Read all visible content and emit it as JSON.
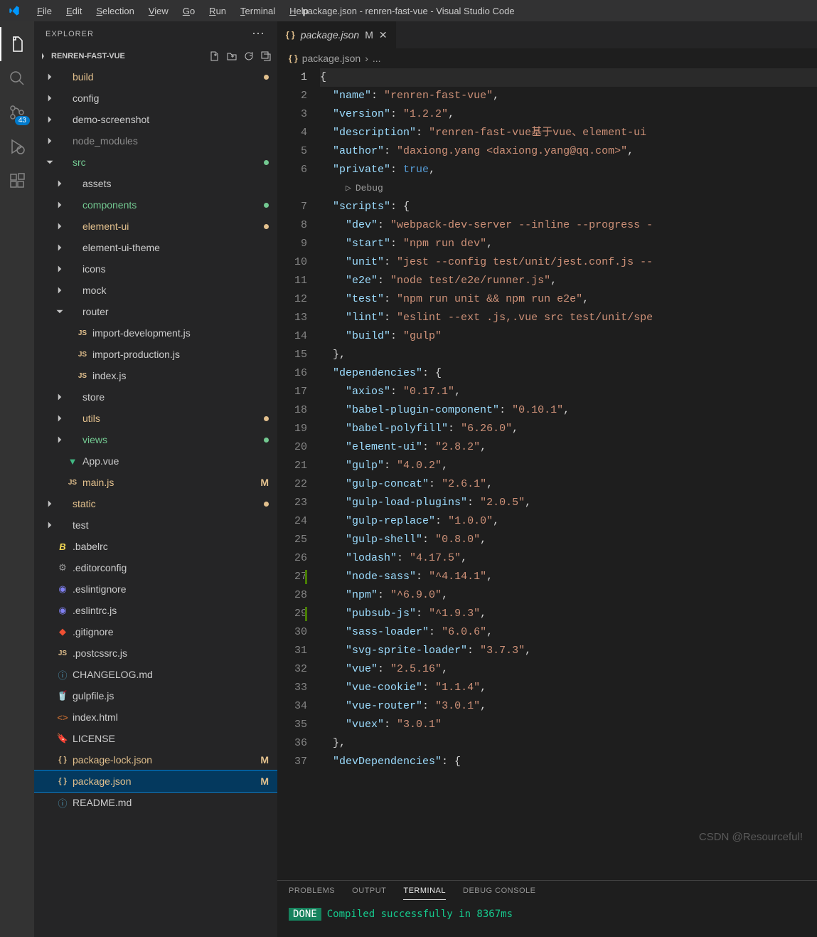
{
  "title": "package.json - renren-fast-vue - Visual Studio Code",
  "menu": [
    {
      "u": "F",
      "rest": "ile"
    },
    {
      "u": "E",
      "rest": "dit"
    },
    {
      "u": "S",
      "rest": "election"
    },
    {
      "u": "V",
      "rest": "iew"
    },
    {
      "u": "G",
      "rest": "o"
    },
    {
      "u": "R",
      "rest": "un"
    },
    {
      "u": "T",
      "rest": "erminal"
    },
    {
      "u": "H",
      "rest": "elp"
    }
  ],
  "activity": {
    "scm_badge": "43"
  },
  "sidebar": {
    "title": "EXPLORER",
    "section": "RENREN-FAST-VUE",
    "tree": [
      {
        "d": 1,
        "t": "folder",
        "open": false,
        "label": "build",
        "cls": "c-modified",
        "dot": "dot-modified"
      },
      {
        "d": 1,
        "t": "folder",
        "open": false,
        "label": "config",
        "cls": "c-default"
      },
      {
        "d": 1,
        "t": "folder",
        "open": false,
        "label": "demo-screenshot",
        "cls": "c-default"
      },
      {
        "d": 1,
        "t": "folder",
        "open": false,
        "label": "node_modules",
        "cls": "c-ignored"
      },
      {
        "d": 1,
        "t": "folder",
        "open": true,
        "label": "src",
        "cls": "c-untracked",
        "dot": "dot-untracked"
      },
      {
        "d": 2,
        "t": "folder",
        "open": false,
        "label": "assets",
        "cls": "c-default"
      },
      {
        "d": 2,
        "t": "folder",
        "open": false,
        "label": "components",
        "cls": "c-untracked",
        "dot": "dot-untracked"
      },
      {
        "d": 2,
        "t": "folder",
        "open": false,
        "label": "element-ui",
        "cls": "c-modified",
        "dot": "dot-modified"
      },
      {
        "d": 2,
        "t": "folder",
        "open": false,
        "label": "element-ui-theme",
        "cls": "c-default"
      },
      {
        "d": 2,
        "t": "folder",
        "open": false,
        "label": "icons",
        "cls": "c-default"
      },
      {
        "d": 2,
        "t": "folder",
        "open": false,
        "label": "mock",
        "cls": "c-default"
      },
      {
        "d": 2,
        "t": "folder",
        "open": true,
        "label": "router",
        "cls": "c-default"
      },
      {
        "d": 3,
        "t": "file",
        "icon": "js",
        "label": "import-development.js",
        "cls": "c-default"
      },
      {
        "d": 3,
        "t": "file",
        "icon": "js",
        "label": "import-production.js",
        "cls": "c-default"
      },
      {
        "d": 3,
        "t": "file",
        "icon": "js",
        "label": "index.js",
        "cls": "c-default"
      },
      {
        "d": 2,
        "t": "folder",
        "open": false,
        "label": "store",
        "cls": "c-default"
      },
      {
        "d": 2,
        "t": "folder",
        "open": false,
        "label": "utils",
        "cls": "c-modified",
        "dot": "dot-modified"
      },
      {
        "d": 2,
        "t": "folder",
        "open": false,
        "label": "views",
        "cls": "c-untracked",
        "dot": "dot-untracked"
      },
      {
        "d": 2,
        "t": "file",
        "icon": "vue",
        "label": "App.vue",
        "cls": "c-default"
      },
      {
        "d": 2,
        "t": "file",
        "icon": "js",
        "label": "main.js",
        "cls": "c-modified",
        "status": "M"
      },
      {
        "d": 1,
        "t": "folder",
        "open": false,
        "label": "static",
        "cls": "c-modified",
        "dot": "dot-modified"
      },
      {
        "d": 1,
        "t": "folder",
        "open": false,
        "label": "test",
        "cls": "c-default"
      },
      {
        "d": 1,
        "t": "file",
        "icon": "babel",
        "label": ".babelrc",
        "cls": "c-default"
      },
      {
        "d": 1,
        "t": "file",
        "icon": "gear",
        "label": ".editorconfig",
        "cls": "c-default"
      },
      {
        "d": 1,
        "t": "file",
        "icon": "eslint",
        "label": ".eslintignore",
        "cls": "c-default"
      },
      {
        "d": 1,
        "t": "file",
        "icon": "eslint",
        "label": ".eslintrc.js",
        "cls": "c-default"
      },
      {
        "d": 1,
        "t": "file",
        "icon": "git",
        "label": ".gitignore",
        "cls": "c-default"
      },
      {
        "d": 1,
        "t": "file",
        "icon": "js",
        "label": ".postcssrc.js",
        "cls": "c-default"
      },
      {
        "d": 1,
        "t": "file",
        "icon": "info",
        "label": "CHANGELOG.md",
        "cls": "c-default"
      },
      {
        "d": 1,
        "t": "file",
        "icon": "gulp",
        "label": "gulpfile.js",
        "cls": "c-default"
      },
      {
        "d": 1,
        "t": "file",
        "icon": "html",
        "label": "index.html",
        "cls": "c-default"
      },
      {
        "d": 1,
        "t": "file",
        "icon": "license",
        "label": "LICENSE",
        "cls": "c-default"
      },
      {
        "d": 1,
        "t": "file",
        "icon": "json",
        "label": "package-lock.json",
        "cls": "c-modified",
        "status": "M"
      },
      {
        "d": 1,
        "t": "file",
        "icon": "json",
        "label": "package.json",
        "cls": "c-modified",
        "status": "M",
        "selected": true
      },
      {
        "d": 1,
        "t": "file",
        "icon": "info",
        "label": "README.md",
        "cls": "c-default"
      }
    ]
  },
  "tab": {
    "name": "package.json",
    "modified": "M"
  },
  "breadcrumb": {
    "file": "package.json",
    "sep": "›",
    "more": "..."
  },
  "codelens": "Debug",
  "code": [
    {
      "n": 1,
      "hl": true,
      "tokens": [
        {
          "c": "p",
          "v": "{"
        }
      ]
    },
    {
      "n": 2,
      "tokens": [
        {
          "c": "p",
          "v": "  "
        },
        {
          "c": "k",
          "v": "\"name\""
        },
        {
          "c": "p",
          "v": ": "
        },
        {
          "c": "s",
          "v": "\"renren-fast-vue\""
        },
        {
          "c": "p",
          "v": ","
        }
      ]
    },
    {
      "n": 3,
      "tokens": [
        {
          "c": "p",
          "v": "  "
        },
        {
          "c": "k",
          "v": "\"version\""
        },
        {
          "c": "p",
          "v": ": "
        },
        {
          "c": "s",
          "v": "\"1.2.2\""
        },
        {
          "c": "p",
          "v": ","
        }
      ]
    },
    {
      "n": 4,
      "tokens": [
        {
          "c": "p",
          "v": "  "
        },
        {
          "c": "k",
          "v": "\"description\""
        },
        {
          "c": "p",
          "v": ": "
        },
        {
          "c": "s",
          "v": "\"renren-fast-vue基于vue、element-ui"
        }
      ]
    },
    {
      "n": 5,
      "tokens": [
        {
          "c": "p",
          "v": "  "
        },
        {
          "c": "k",
          "v": "\"author\""
        },
        {
          "c": "p",
          "v": ": "
        },
        {
          "c": "s",
          "v": "\"daxiong.yang <daxiong.yang@qq.com>\""
        },
        {
          "c": "p",
          "v": ","
        }
      ]
    },
    {
      "n": 6,
      "tokens": [
        {
          "c": "p",
          "v": "  "
        },
        {
          "c": "k",
          "v": "\"private\""
        },
        {
          "c": "p",
          "v": ": "
        },
        {
          "c": "b",
          "v": "true"
        },
        {
          "c": "p",
          "v": ","
        }
      ]
    },
    {
      "codelens": true
    },
    {
      "n": 7,
      "tokens": [
        {
          "c": "p",
          "v": "  "
        },
        {
          "c": "k",
          "v": "\"scripts\""
        },
        {
          "c": "p",
          "v": ": {"
        }
      ]
    },
    {
      "n": 8,
      "tokens": [
        {
          "c": "p",
          "v": "    "
        },
        {
          "c": "k",
          "v": "\"dev\""
        },
        {
          "c": "p",
          "v": ": "
        },
        {
          "c": "s",
          "v": "\"webpack-dev-server --inline --progress -"
        }
      ]
    },
    {
      "n": 9,
      "tokens": [
        {
          "c": "p",
          "v": "    "
        },
        {
          "c": "k",
          "v": "\"start\""
        },
        {
          "c": "p",
          "v": ": "
        },
        {
          "c": "s",
          "v": "\"npm run dev\""
        },
        {
          "c": "p",
          "v": ","
        }
      ]
    },
    {
      "n": 10,
      "tokens": [
        {
          "c": "p",
          "v": "    "
        },
        {
          "c": "k",
          "v": "\"unit\""
        },
        {
          "c": "p",
          "v": ": "
        },
        {
          "c": "s",
          "v": "\"jest --config test/unit/jest.conf.js --"
        }
      ]
    },
    {
      "n": 11,
      "tokens": [
        {
          "c": "p",
          "v": "    "
        },
        {
          "c": "k",
          "v": "\"e2e\""
        },
        {
          "c": "p",
          "v": ": "
        },
        {
          "c": "s",
          "v": "\"node test/e2e/runner.js\""
        },
        {
          "c": "p",
          "v": ","
        }
      ]
    },
    {
      "n": 12,
      "tokens": [
        {
          "c": "p",
          "v": "    "
        },
        {
          "c": "k",
          "v": "\"test\""
        },
        {
          "c": "p",
          "v": ": "
        },
        {
          "c": "s",
          "v": "\"npm run unit && npm run e2e\""
        },
        {
          "c": "p",
          "v": ","
        }
      ]
    },
    {
      "n": 13,
      "tokens": [
        {
          "c": "p",
          "v": "    "
        },
        {
          "c": "k",
          "v": "\"lint\""
        },
        {
          "c": "p",
          "v": ": "
        },
        {
          "c": "s",
          "v": "\"eslint --ext .js,.vue src test/unit/spe"
        }
      ]
    },
    {
      "n": 14,
      "tokens": [
        {
          "c": "p",
          "v": "    "
        },
        {
          "c": "k",
          "v": "\"build\""
        },
        {
          "c": "p",
          "v": ": "
        },
        {
          "c": "s",
          "v": "\"gulp\""
        }
      ]
    },
    {
      "n": 15,
      "tokens": [
        {
          "c": "p",
          "v": "  },"
        }
      ]
    },
    {
      "n": 16,
      "tokens": [
        {
          "c": "p",
          "v": "  "
        },
        {
          "c": "k",
          "v": "\"dependencies\""
        },
        {
          "c": "p",
          "v": ": {"
        }
      ]
    },
    {
      "n": 17,
      "tokens": [
        {
          "c": "p",
          "v": "    "
        },
        {
          "c": "k",
          "v": "\"axios\""
        },
        {
          "c": "p",
          "v": ": "
        },
        {
          "c": "s",
          "v": "\"0.17.1\""
        },
        {
          "c": "p",
          "v": ","
        }
      ]
    },
    {
      "n": 18,
      "tokens": [
        {
          "c": "p",
          "v": "    "
        },
        {
          "c": "k",
          "v": "\"babel-plugin-component\""
        },
        {
          "c": "p",
          "v": ": "
        },
        {
          "c": "s",
          "v": "\"0.10.1\""
        },
        {
          "c": "p",
          "v": ","
        }
      ]
    },
    {
      "n": 19,
      "tokens": [
        {
          "c": "p",
          "v": "    "
        },
        {
          "c": "k",
          "v": "\"babel-polyfill\""
        },
        {
          "c": "p",
          "v": ": "
        },
        {
          "c": "s",
          "v": "\"6.26.0\""
        },
        {
          "c": "p",
          "v": ","
        }
      ]
    },
    {
      "n": 20,
      "tokens": [
        {
          "c": "p",
          "v": "    "
        },
        {
          "c": "k",
          "v": "\"element-ui\""
        },
        {
          "c": "p",
          "v": ": "
        },
        {
          "c": "s",
          "v": "\"2.8.2\""
        },
        {
          "c": "p",
          "v": ","
        }
      ]
    },
    {
      "n": 21,
      "tokens": [
        {
          "c": "p",
          "v": "    "
        },
        {
          "c": "k",
          "v": "\"gulp\""
        },
        {
          "c": "p",
          "v": ": "
        },
        {
          "c": "s",
          "v": "\"4.0.2\""
        },
        {
          "c": "p",
          "v": ","
        }
      ]
    },
    {
      "n": 22,
      "tokens": [
        {
          "c": "p",
          "v": "    "
        },
        {
          "c": "k",
          "v": "\"gulp-concat\""
        },
        {
          "c": "p",
          "v": ": "
        },
        {
          "c": "s",
          "v": "\"2.6.1\""
        },
        {
          "c": "p",
          "v": ","
        }
      ]
    },
    {
      "n": 23,
      "tokens": [
        {
          "c": "p",
          "v": "    "
        },
        {
          "c": "k",
          "v": "\"gulp-load-plugins\""
        },
        {
          "c": "p",
          "v": ": "
        },
        {
          "c": "s",
          "v": "\"2.0.5\""
        },
        {
          "c": "p",
          "v": ","
        }
      ]
    },
    {
      "n": 24,
      "tokens": [
        {
          "c": "p",
          "v": "    "
        },
        {
          "c": "k",
          "v": "\"gulp-replace\""
        },
        {
          "c": "p",
          "v": ": "
        },
        {
          "c": "s",
          "v": "\"1.0.0\""
        },
        {
          "c": "p",
          "v": ","
        }
      ]
    },
    {
      "n": 25,
      "tokens": [
        {
          "c": "p",
          "v": "    "
        },
        {
          "c": "k",
          "v": "\"gulp-shell\""
        },
        {
          "c": "p",
          "v": ": "
        },
        {
          "c": "s",
          "v": "\"0.8.0\""
        },
        {
          "c": "p",
          "v": ","
        }
      ]
    },
    {
      "n": 26,
      "tokens": [
        {
          "c": "p",
          "v": "    "
        },
        {
          "c": "k",
          "v": "\"lodash\""
        },
        {
          "c": "p",
          "v": ": "
        },
        {
          "c": "s",
          "v": "\"4.17.5\""
        },
        {
          "c": "p",
          "v": ","
        }
      ]
    },
    {
      "n": 27,
      "mod": true,
      "tokens": [
        {
          "c": "p",
          "v": "    "
        },
        {
          "c": "k",
          "v": "\"node-sass\""
        },
        {
          "c": "p",
          "v": ": "
        },
        {
          "c": "s",
          "v": "\"^4.14.1\""
        },
        {
          "c": "p",
          "v": ","
        }
      ]
    },
    {
      "n": 28,
      "tokens": [
        {
          "c": "p",
          "v": "    "
        },
        {
          "c": "k",
          "v": "\"npm\""
        },
        {
          "c": "p",
          "v": ": "
        },
        {
          "c": "s",
          "v": "\"^6.9.0\""
        },
        {
          "c": "p",
          "v": ","
        }
      ]
    },
    {
      "n": 29,
      "mod": true,
      "tokens": [
        {
          "c": "p",
          "v": "    "
        },
        {
          "c": "k",
          "v": "\"pubsub-js\""
        },
        {
          "c": "p",
          "v": ": "
        },
        {
          "c": "s",
          "v": "\"^1.9.3\""
        },
        {
          "c": "p",
          "v": ","
        }
      ]
    },
    {
      "n": 30,
      "tokens": [
        {
          "c": "p",
          "v": "    "
        },
        {
          "c": "k",
          "v": "\"sass-loader\""
        },
        {
          "c": "p",
          "v": ": "
        },
        {
          "c": "s",
          "v": "\"6.0.6\""
        },
        {
          "c": "p",
          "v": ","
        }
      ]
    },
    {
      "n": 31,
      "tokens": [
        {
          "c": "p",
          "v": "    "
        },
        {
          "c": "k",
          "v": "\"svg-sprite-loader\""
        },
        {
          "c": "p",
          "v": ": "
        },
        {
          "c": "s",
          "v": "\"3.7.3\""
        },
        {
          "c": "p",
          "v": ","
        }
      ]
    },
    {
      "n": 32,
      "tokens": [
        {
          "c": "p",
          "v": "    "
        },
        {
          "c": "k",
          "v": "\"vue\""
        },
        {
          "c": "p",
          "v": ": "
        },
        {
          "c": "s",
          "v": "\"2.5.16\""
        },
        {
          "c": "p",
          "v": ","
        }
      ]
    },
    {
      "n": 33,
      "tokens": [
        {
          "c": "p",
          "v": "    "
        },
        {
          "c": "k",
          "v": "\"vue-cookie\""
        },
        {
          "c": "p",
          "v": ": "
        },
        {
          "c": "s",
          "v": "\"1.1.4\""
        },
        {
          "c": "p",
          "v": ","
        }
      ]
    },
    {
      "n": 34,
      "tokens": [
        {
          "c": "p",
          "v": "    "
        },
        {
          "c": "k",
          "v": "\"vue-router\""
        },
        {
          "c": "p",
          "v": ": "
        },
        {
          "c": "s",
          "v": "\"3.0.1\""
        },
        {
          "c": "p",
          "v": ","
        }
      ]
    },
    {
      "n": 35,
      "tokens": [
        {
          "c": "p",
          "v": "    "
        },
        {
          "c": "k",
          "v": "\"vuex\""
        },
        {
          "c": "p",
          "v": ": "
        },
        {
          "c": "s",
          "v": "\"3.0.1\""
        }
      ]
    },
    {
      "n": 36,
      "tokens": [
        {
          "c": "p",
          "v": "  },"
        }
      ]
    },
    {
      "n": 37,
      "tokens": [
        {
          "c": "p",
          "v": "  "
        },
        {
          "c": "k",
          "v": "\"devDependencies\""
        },
        {
          "c": "p",
          "v": ": {"
        }
      ]
    }
  ],
  "panel": {
    "tabs": [
      "PROBLEMS",
      "OUTPUT",
      "TERMINAL",
      "DEBUG CONSOLE"
    ],
    "active": 2,
    "done": "DONE",
    "msg": "Compiled successfully in 8367ms"
  },
  "watermark": "CSDN @Resourceful!"
}
